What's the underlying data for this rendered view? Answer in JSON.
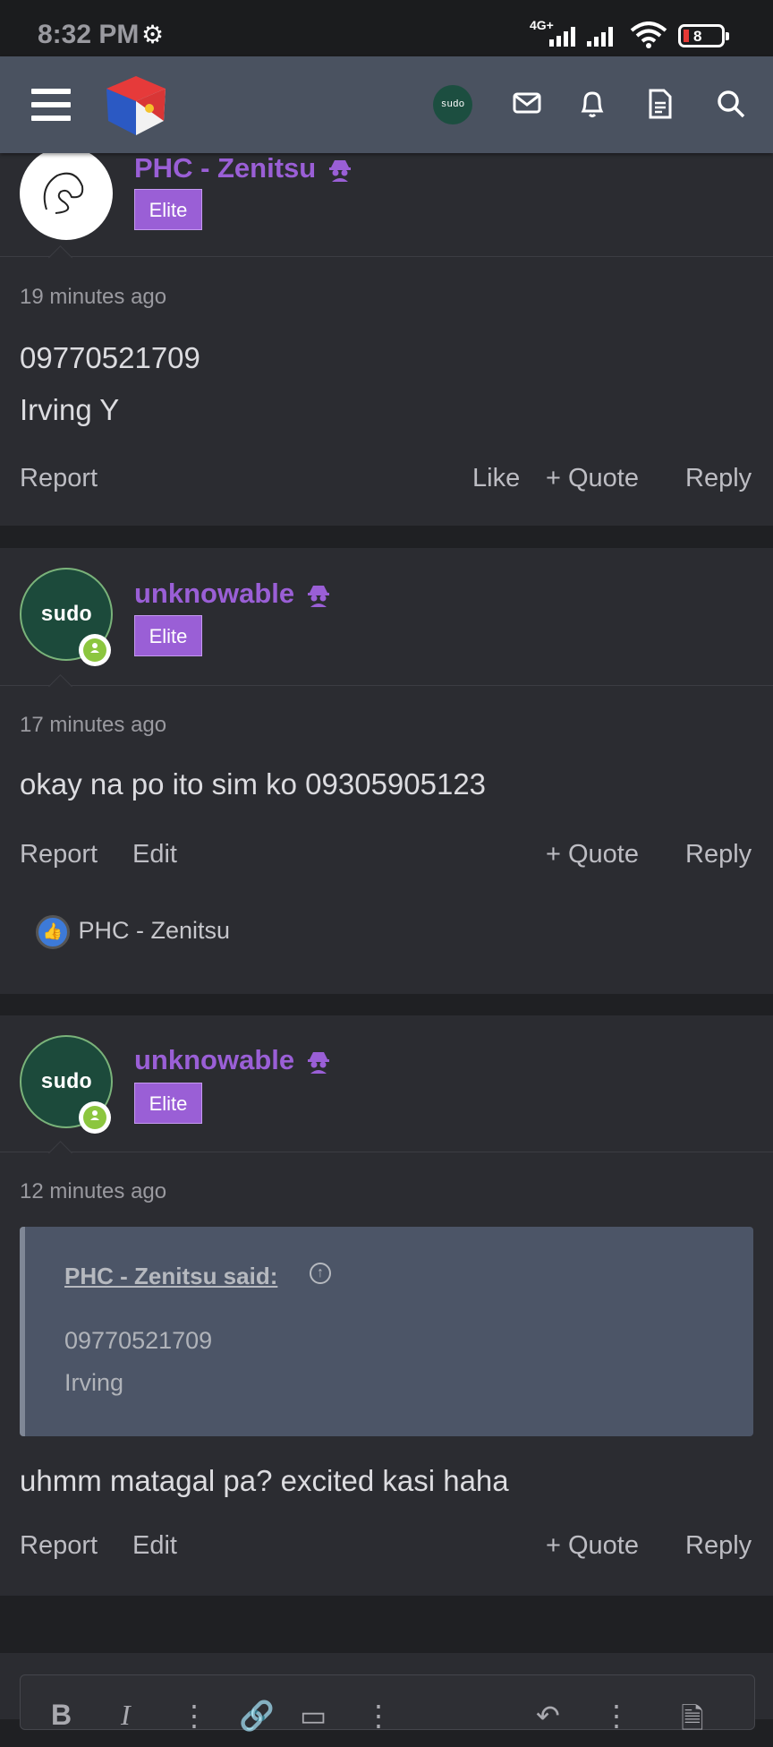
{
  "status_bar": {
    "time": "8:32 PM",
    "network": "4G+",
    "battery": "8"
  },
  "header": {
    "avatar_text": "sudo"
  },
  "posts": [
    {
      "username": "PHC - Zenitsu",
      "badge": "Elite",
      "time": "19 minutes ago",
      "lines": [
        "09770521709",
        "Irving Y"
      ],
      "actions": {
        "report": "Report",
        "like": "Like",
        "quote": "+ Quote",
        "reply": "Reply"
      }
    },
    {
      "username": "unknowable",
      "badge": "Elite",
      "avatar_text": "sudo",
      "time": "17 minutes ago",
      "lines": [
        "okay na po ito sim ko 09305905123"
      ],
      "actions": {
        "report": "Report",
        "edit": "Edit",
        "quote": "+ Quote",
        "reply": "Reply"
      },
      "reaction_user": "PHC - Zenitsu"
    },
    {
      "username": "unknowable",
      "badge": "Elite",
      "avatar_text": "sudo",
      "time": "12 minutes ago",
      "quote": {
        "author": "PHC - Zenitsu said:",
        "lines": [
          "09770521709",
          "Irving"
        ]
      },
      "lines": [
        "uhmm matagal pa? excited kasi haha"
      ],
      "actions": {
        "report": "Report",
        "edit": "Edit",
        "quote": "+ Quote",
        "reply": "Reply"
      }
    }
  ],
  "editor": {
    "bold": "B",
    "italic": "I"
  },
  "icons": [
    "menu-icon",
    "site-logo",
    "mail-icon",
    "bell-icon",
    "document-icon",
    "search-icon",
    "spy-icon",
    "thumbs-up-icon",
    "arrow-up-circle-icon",
    "person-icon",
    "gear-icon",
    "signal-icon",
    "wifi-icon",
    "battery-icon"
  ],
  "colors": {
    "accent": "#9a5fd6",
    "header": "#4a5260",
    "post_bg": "#2b2c31",
    "online": "#8cc63f"
  }
}
